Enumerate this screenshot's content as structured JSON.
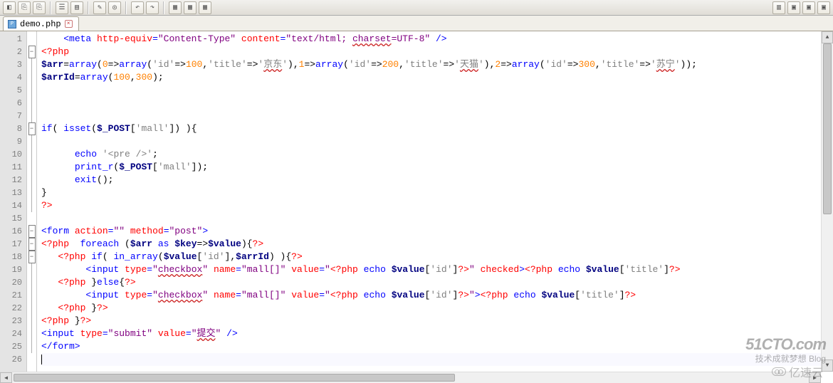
{
  "tab": {
    "filename": "demo.php"
  },
  "code": {
    "lines": [
      {
        "n": 1,
        "fold": "",
        "html": "    <span class='k-blue'>&lt;meta</span> <span class='k-red'>http-equiv</span><span class='k-blue'>=</span><span class='k-purple'>\"Content-Type\"</span> <span class='k-red'>content</span><span class='k-blue'>=</span><span class='k-purple'>\"text/html; <span class='wavy'>charset</span>=UTF-8\"</span> <span class='k-blue'>/&gt;</span>"
      },
      {
        "n": 2,
        "fold": "-",
        "html": "<span class='k-red'>&lt;?php</span>"
      },
      {
        "n": 3,
        "fold": "|",
        "html": "<span class='k-navy'>$arr</span>=<span class='k-blue'>array</span>(<span class='k-orange'>0</span>=&gt;<span class='k-blue'>array</span>(<span class='k-gray'>'id'</span>=&gt;<span class='k-orange'>100</span>,<span class='k-gray'>'title'</span>=&gt;<span class='k-gray'>'<span class='wavy'>京东</span>'</span>),<span class='k-orange'>1</span>=&gt;<span class='k-blue'>array</span>(<span class='k-gray'>'id'</span>=&gt;<span class='k-orange'>200</span>,<span class='k-gray'>'title'</span>=&gt;<span class='k-gray'>'<span class='wavy'>天猫</span>'</span>),<span class='k-orange'>2</span>=&gt;<span class='k-blue'>array</span>(<span class='k-gray'>'id'</span>=&gt;<span class='k-orange'>300</span>,<span class='k-gray'>'title'</span>=&gt;<span class='k-gray'>'<span class='wavy'>苏宁</span>'</span>));"
      },
      {
        "n": 4,
        "fold": "|",
        "html": "<span class='k-navy'>$arrId</span>=<span class='k-blue'>array</span>(<span class='k-orange'>100</span>,<span class='k-orange'>300</span>);"
      },
      {
        "n": 5,
        "fold": "|",
        "html": ""
      },
      {
        "n": 6,
        "fold": "|",
        "html": ""
      },
      {
        "n": 7,
        "fold": "|",
        "html": ""
      },
      {
        "n": 8,
        "fold": "-",
        "html": "<span class='k-blue'>if</span>( <span class='k-blue'>isset</span>(<span class='k-navy'>$_POST</span>[<span class='k-gray'>'mall'</span>]) ){"
      },
      {
        "n": 9,
        "fold": "|",
        "html": ""
      },
      {
        "n": 10,
        "fold": "|",
        "html": "      <span class='k-blue'>echo</span> <span class='k-gray'>'&lt;pre /&gt;'</span>;"
      },
      {
        "n": 11,
        "fold": "|",
        "html": "      <span class='k-blue'>print_r</span>(<span class='k-navy'>$_POST</span>[<span class='k-gray'>'mall'</span>]);"
      },
      {
        "n": 12,
        "fold": "|",
        "html": "      <span class='k-blue'>exit</span>();"
      },
      {
        "n": 13,
        "fold": "|",
        "html": "}"
      },
      {
        "n": 14,
        "fold": "|",
        "html": "<span class='k-red'>?&gt;</span>"
      },
      {
        "n": 15,
        "fold": "",
        "html": ""
      },
      {
        "n": 16,
        "fold": "-",
        "html": "<span class='k-blue'>&lt;form</span> <span class='k-red'>action</span><span class='k-blue'>=</span><span class='k-purple'>\"\"</span> <span class='k-red'>method</span><span class='k-blue'>=</span><span class='k-purple'>\"post\"</span><span class='k-blue'>&gt;</span>"
      },
      {
        "n": 17,
        "fold": "-",
        "html": "<span class='k-red'>&lt;?php</span>  <span class='k-blue'>foreach</span> (<span class='k-navy'>$arr</span> <span class='k-blue'>as</span> <span class='k-navy'>$key</span>=&gt;<span class='k-navy'>$value</span>){<span class='k-red'>?&gt;</span>"
      },
      {
        "n": 18,
        "fold": "-",
        "html": "   <span class='k-red'>&lt;?php</span> <span class='k-blue'>if</span>( <span class='k-blue'>in_array</span>(<span class='k-navy'>$value</span>[<span class='k-gray'>'id'</span>],<span class='k-navy'>$arrId</span>) ){<span class='k-red'>?&gt;</span>"
      },
      {
        "n": 19,
        "fold": "|",
        "html": "        <span class='k-blue'>&lt;input</span> <span class='k-red'>type</span><span class='k-blue'>=</span><span class='k-purple'>\"<span class='wavy'>checkbox</span>\"</span> <span class='k-red'>name</span><span class='k-blue'>=</span><span class='k-purple'>\"mall[]\"</span> <span class='k-red'>value</span><span class='k-blue'>=</span><span class='k-purple'>\"</span><span class='k-red'>&lt;?php</span> <span class='k-blue'>echo</span> <span class='k-navy'>$value</span>[<span class='k-gray'>'id'</span>]<span class='k-red'>?&gt;</span><span class='k-purple'>\"</span> <span class='k-red'>checked</span><span class='k-blue'>&gt;</span><span class='k-red'>&lt;?php</span> <span class='k-blue'>echo</span> <span class='k-navy'>$value</span>[<span class='k-gray'>'title'</span>]<span class='k-red'>?&gt;</span>"
      },
      {
        "n": 20,
        "fold": "|",
        "html": "   <span class='k-red'>&lt;?php</span> }<span class='k-blue'>else</span>{<span class='k-red'>?&gt;</span>"
      },
      {
        "n": 21,
        "fold": "|",
        "html": "        <span class='k-blue'>&lt;input</span> <span class='k-red'>type</span><span class='k-blue'>=</span><span class='k-purple'>\"<span class='wavy'>checkbox</span>\"</span> <span class='k-red'>name</span><span class='k-blue'>=</span><span class='k-purple'>\"mall[]\"</span> <span class='k-red'>value</span><span class='k-blue'>=</span><span class='k-purple'>\"</span><span class='k-red'>&lt;?php</span> <span class='k-blue'>echo</span> <span class='k-navy'>$value</span>[<span class='k-gray'>'id'</span>]<span class='k-red'>?&gt;</span><span class='k-purple'>\"</span><span class='k-blue'>&gt;</span><span class='k-red'>&lt;?php</span> <span class='k-blue'>echo</span> <span class='k-navy'>$value</span>[<span class='k-gray'>'title'</span>]<span class='k-red'>?&gt;</span>"
      },
      {
        "n": 22,
        "fold": "|",
        "html": "   <span class='k-red'>&lt;?php</span> }<span class='k-red'>?&gt;</span>"
      },
      {
        "n": 23,
        "fold": "|",
        "html": "<span class='k-red'>&lt;?php</span> }<span class='k-red'>?&gt;</span>"
      },
      {
        "n": 24,
        "fold": "|",
        "html": "<span class='k-blue'>&lt;input</span> <span class='k-red'>type</span><span class='k-blue'>=</span><span class='k-purple'>\"submit\"</span> <span class='k-red'>value</span><span class='k-blue'>=</span><span class='k-purple'>\"<span class='wavy'>提交</span>\"</span> <span class='k-blue'>/&gt;</span>"
      },
      {
        "n": 25,
        "fold": "|",
        "html": "<span class='k-blue'>&lt;/form&gt;</span>"
      },
      {
        "n": 26,
        "fold": "",
        "html": "<span class='caret'></span>",
        "current": true
      }
    ]
  },
  "watermarks": {
    "w1_big": "51CTO.com",
    "w1_small": "技术成就梦想   Blog",
    "w2": "亿速云"
  }
}
